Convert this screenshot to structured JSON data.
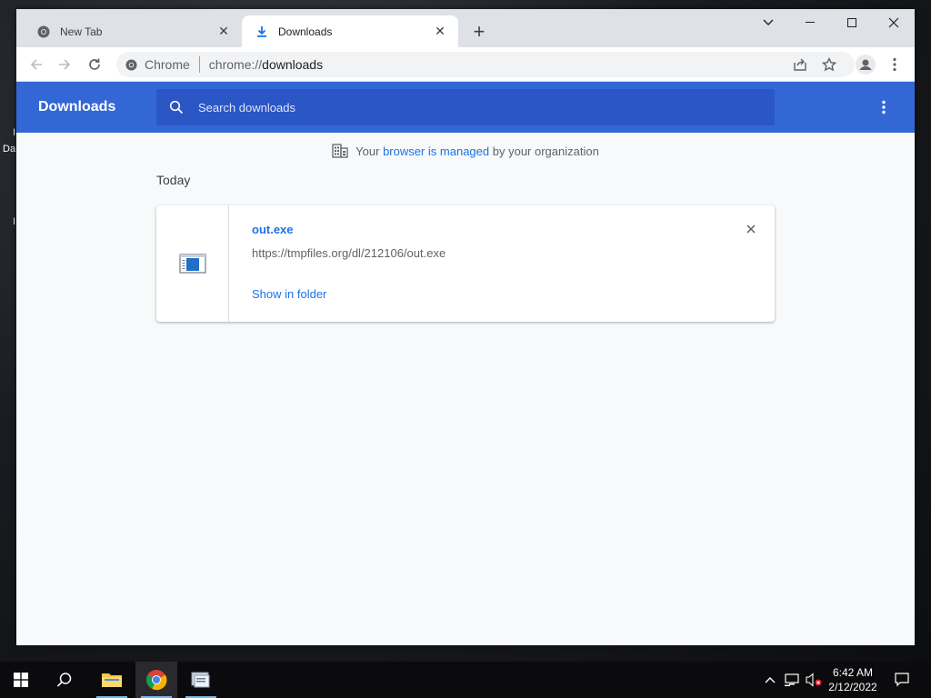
{
  "desktop": {
    "fragment_1": "I",
    "fragment_2": "Da",
    "fragment_3": "I"
  },
  "tabs": [
    {
      "title": "New Tab",
      "icon": "chrome-icon",
      "active": false
    },
    {
      "title": "Downloads",
      "icon": "download-icon",
      "active": true
    }
  ],
  "toolbar": {
    "site_chip": "Chrome",
    "url_scheme": "chrome://",
    "url_host": "downloads"
  },
  "app": {
    "title": "Downloads",
    "search_placeholder": "Search downloads"
  },
  "managed_notice": {
    "prefix": "Your",
    "link": "browser is managed",
    "suffix": "by your organization"
  },
  "downloads": {
    "day_label": "Today",
    "items": [
      {
        "file_name": "out.exe",
        "url": "https://tmpfiles.org/dl/212106/out.exe",
        "action": "Show in folder"
      }
    ]
  },
  "taskbar": {
    "time": "6:42 AM",
    "date": "2/12/2022"
  },
  "colors": {
    "accent": "#3367d6",
    "search_bg": "#2a56c6",
    "link": "#1a73e8"
  }
}
